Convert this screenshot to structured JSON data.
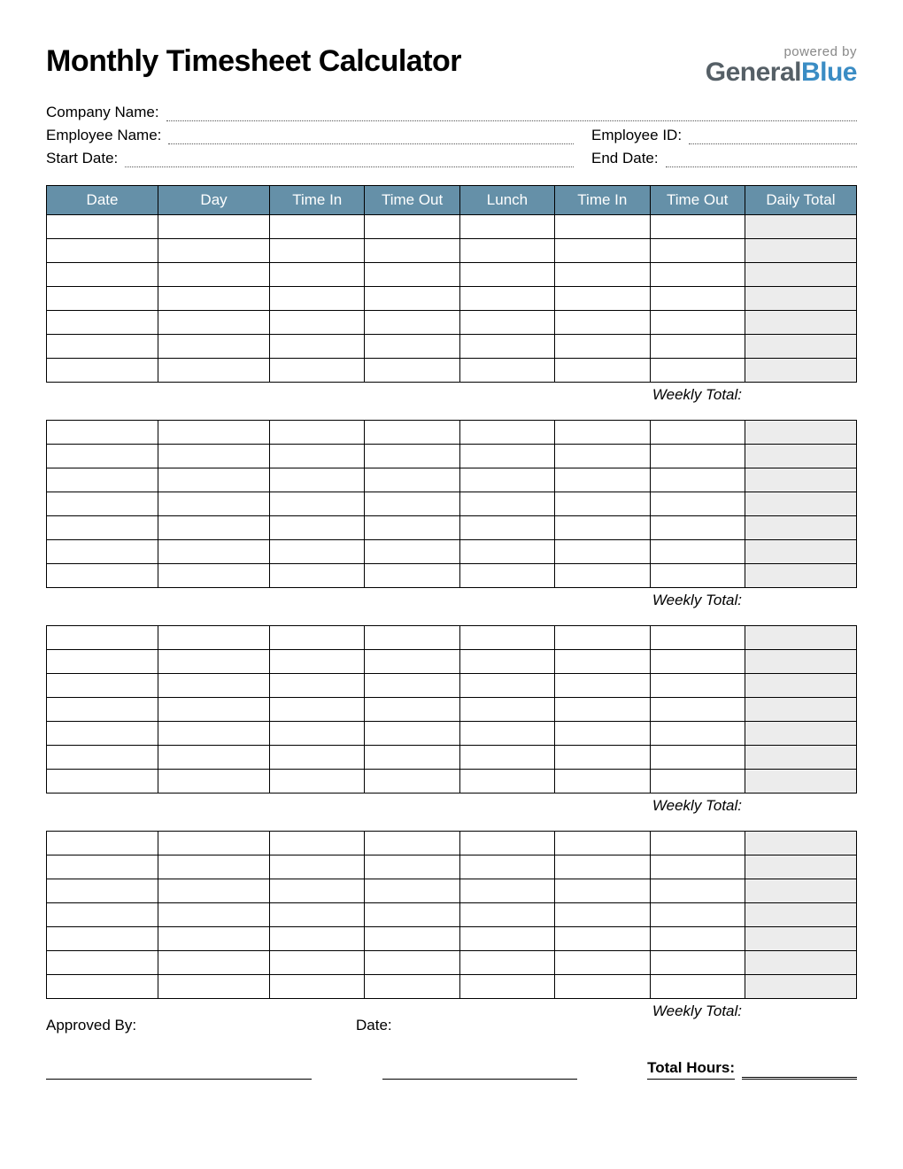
{
  "title": "Monthly Timesheet Calculator",
  "logo": {
    "powered_by": "powered by",
    "part1": "General",
    "part2": "Blue"
  },
  "info": {
    "company_label": "Company Name:",
    "employee_label": "Employee Name:",
    "employee_id_label": "Employee ID:",
    "start_date_label": "Start Date:",
    "end_date_label": "End Date:"
  },
  "columns": {
    "date": "Date",
    "day": "Day",
    "time_in": "Time In",
    "time_out": "Time Out",
    "lunch": "Lunch",
    "time_in2": "Time In",
    "time_out2": "Time Out",
    "daily_total": "Daily Total"
  },
  "weekly_total_label": "Weekly Total:",
  "weeks": 4,
  "rows_per_week": 7,
  "footer": {
    "approved_by": "Approved By:",
    "date": "Date:",
    "total_hours": "Total Hours:"
  }
}
